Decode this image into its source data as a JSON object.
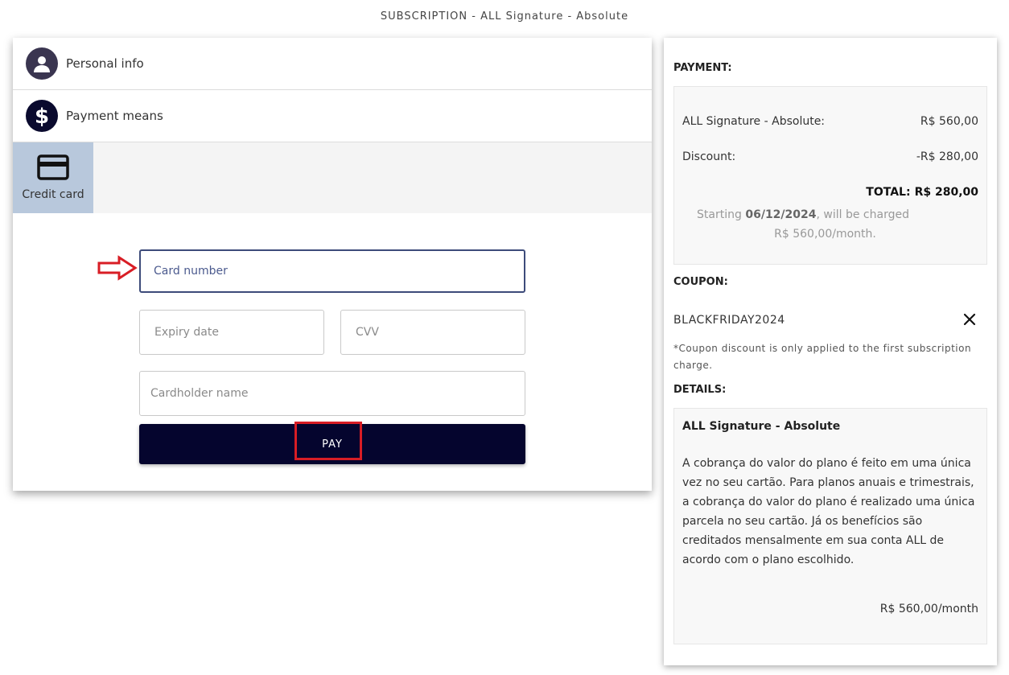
{
  "header": {
    "title": "SUBSCRIPTION - ALL Signature - Absolute"
  },
  "steps": [
    {
      "label": "Personal info",
      "icon": "person-icon"
    },
    {
      "label": "Payment means",
      "icon": "dollar-icon"
    }
  ],
  "payment_tabs": [
    {
      "label": "Credit card",
      "icon": "credit-card-icon",
      "selected": true
    }
  ],
  "form": {
    "card_number_placeholder": "Card number",
    "expiry_placeholder": "Expiry date",
    "cvv_placeholder": "CVV",
    "cardholder_placeholder": "Cardholder name",
    "pay_label": "PAY"
  },
  "summary": {
    "payment_heading": "PAYMENT:",
    "plan_label": "ALL Signature - Absolute:",
    "plan_price": "R$ 560,00",
    "discount_label": "Discount:",
    "discount_value": "-R$ 280,00",
    "total_label": "TOTAL:",
    "total_value": "R$ 280,00",
    "starting_prefix": "Starting ",
    "starting_date": "06/12/2024",
    "starting_suffix": ", will be charged",
    "monthly_charge": "R$ 560,00/month."
  },
  "coupon": {
    "heading": "COUPON:",
    "code": "BLACKFRIDAY2024",
    "note": "*Coupon discount is only applied to the first subscription charge."
  },
  "details": {
    "heading": "DETAILS:",
    "plan_name": "ALL Signature - Absolute",
    "description": "A cobrança do valor do plano é feito em uma única vez no seu cartão. Para planos anuais e trimestrais, a cobrança do valor do plano é realizado uma única parcela no seu cartão. Já os benefícios são creditados mensalmente em sua conta ALL de acordo com o plano escolhido.",
    "price": "R$ 560,00/month"
  },
  "colors": {
    "brand_dark": "#05052e",
    "tab_selected": "#b8c8dc",
    "highlight_red": "#d81d25",
    "focus_border": "#3d4b7a"
  }
}
